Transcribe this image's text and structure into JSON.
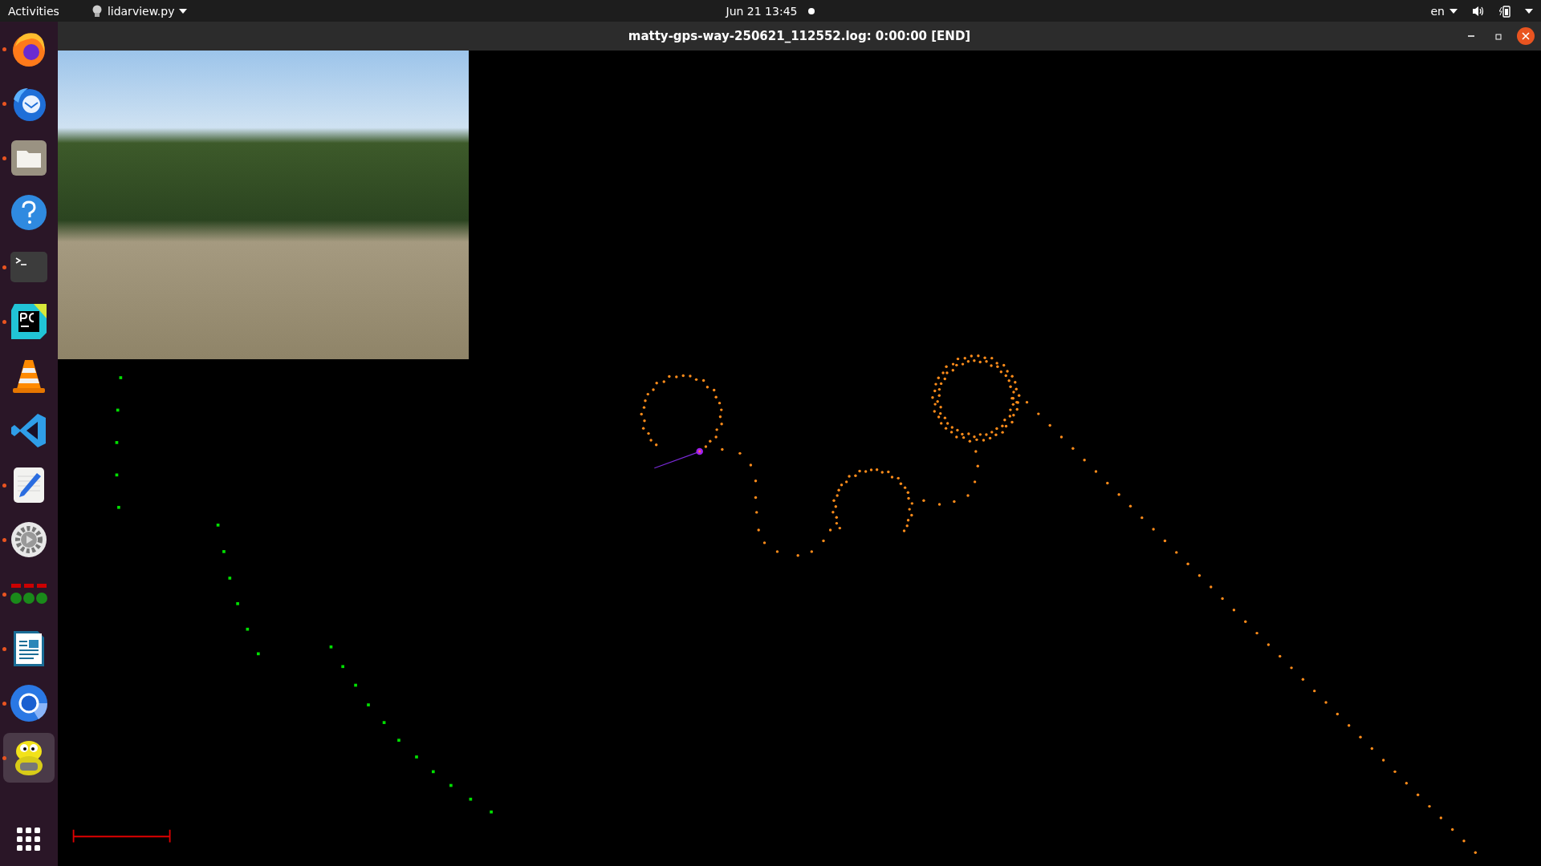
{
  "top_bar": {
    "activities": "Activities",
    "app_menu": "lidarview.py",
    "clock": "Jun 21  13:45",
    "input_source": "en"
  },
  "window": {
    "title": "matty-gps-way-250621_112552.log: 0:00:00 [END]"
  },
  "dock": {
    "items": [
      {
        "kind": "flame-globe",
        "running": true,
        "selected": false
      },
      {
        "kind": "bird-envelope",
        "running": true,
        "selected": false
      },
      {
        "kind": "folder",
        "running": true,
        "selected": false
      },
      {
        "kind": "help",
        "running": false,
        "selected": false
      },
      {
        "kind": "terminal",
        "running": true,
        "selected": false
      },
      {
        "kind": "pc-logo",
        "running": true,
        "selected": false
      },
      {
        "kind": "cone",
        "running": false,
        "selected": false
      },
      {
        "kind": "code-ribbon",
        "running": false,
        "selected": false
      },
      {
        "kind": "pencil-doc",
        "running": true,
        "selected": false
      },
      {
        "kind": "gear",
        "running": true,
        "selected": false
      },
      {
        "kind": "blocks",
        "running": true,
        "selected": false
      },
      {
        "kind": "document-image",
        "running": true,
        "selected": false
      },
      {
        "kind": "ring",
        "running": true,
        "selected": false
      },
      {
        "kind": "mascot",
        "running": true,
        "selected": true
      }
    ]
  }
}
